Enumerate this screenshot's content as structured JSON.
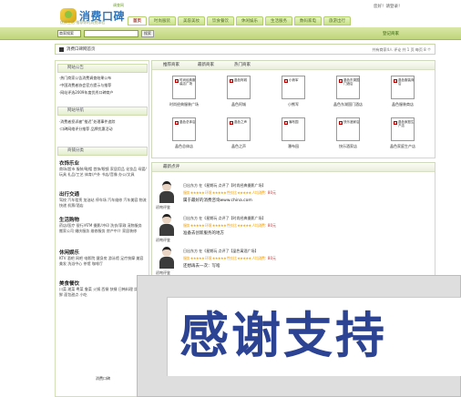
{
  "header": {
    "logo_text": "消费口碑",
    "logo_small": "调查网",
    "slogan": "优质生活·推荐你的消费体验",
    "login_text": "您好！请登录！"
  },
  "nav": {
    "items": [
      "首页",
      "时尚服装",
      "美容美妆",
      "饮食餐饮",
      "休闲娱乐",
      "生活服务",
      "数码家电",
      "旅游出行"
    ],
    "active_index": 0
  },
  "subnav": {
    "search_select": "商家搜索",
    "search_placeholder": "",
    "search_button": "搜索",
    "register_link": "登记商家"
  },
  "breadcrumb": {
    "text": "消费口碑网首页",
    "right_text": "共有商家4人   评论    共 1 页    每页 8 个"
  },
  "sidebar": {
    "section1_title": "网站公告",
    "notices": [
      "·热门商家公告消费调查结果公布",
      "·中国消费者协会官方提示与推荐",
      "·网站评选2009年度优秀口碑商户"
    ],
    "section2_title": "网站导航",
    "guide_lines": [
      "·消费者投诉被“推迟”处理事件追踪",
      "·口碑网络评分推荐 品牌优惠活动"
    ],
    "section3_title": "商铺分类",
    "categories": [
      {
        "name": "衣饰乐业",
        "links": "商场/超市 服装/鞋帽 首饰/眼镜 家居用品 化妆品 母婴/玩具 礼品/工艺 体育/户外 书店/音像 办公/文具"
      },
      {
        "name": "出行交通",
        "links": "驾校 汽车租赁 加油站 停车场 汽车维修 汽车美容 物流快递 机票/酒店"
      },
      {
        "name": "生活购物",
        "links": "药店/医疗 银行/ATM 摄影/冲印 洗衣/家政 宠物服务 搬家公司 婚庆服务 维修服务 房产中介 家居装修"
      },
      {
        "name": "休闲娱乐",
        "links": "KTV 酒吧 网吧 电影院 健身房 游泳馆 足疗按摩 美容美发 洗浴中心 茶馆 咖啡厅"
      },
      {
        "name": "美食餐饮",
        "links": "川菜 湘菜 粤菜 鲁菜 火锅 西餐 快餐 日韩料理 烧烤 海鲜 面包甜点 小吃"
      }
    ],
    "footer_text": "消费口碑"
  },
  "tabs_box": {
    "tabs": [
      "推荐商家",
      "最新商家",
      "热门商家"
    ],
    "items": [
      {
        "thumb": "时尚经典服装店广场",
        "label": "时尚经典服装广场"
      },
      {
        "thumb": "晶色阿城",
        "label": "晶色阿城"
      },
      {
        "thumb": "小熊军",
        "label": "小熊军"
      },
      {
        "thumb": "晶色东湖国门酒店",
        "label": "晶色东湖国门酒店"
      },
      {
        "thumb": "晶色服装商店",
        "label": "晶色服装商店"
      },
      {
        "thumb": "晶色总体店",
        "label": "晶色总体店"
      },
      {
        "thumb": "晶色之声",
        "label": "晶色之声"
      },
      {
        "thumb": "瀑布园",
        "label": "瀑布园"
      },
      {
        "thumb": "快乐酒家店",
        "label": "快乐酒家店"
      },
      {
        "thumb": "晶色家庭生产店",
        "label": "晶色家庭生产店"
      }
    ]
  },
  "reviews": {
    "title": "最新点评",
    "items": [
      {
        "user": "初吻评鉴",
        "meta": "日出东方 在《星期玩 点评了【时尚经典摄影广场】",
        "ratings": "服务 ★★★★★ 环境 ★★★★★ 性价比 ★★★★★ 人均消费：",
        "price": "80元",
        "content": "属于最好的消费咨询www.china.com"
      },
      {
        "user": "初吻评鉴",
        "meta": "日出东方 在《星期玩 点评了【时尚经典摄影广场】",
        "ratings": "服务 ★★★★★ 环境 ★★★★★ 性价比 ★★★★★ 人均消费：",
        "price": "80元",
        "content": "准备去创新服务的地方"
      },
      {
        "user": "初吻评鉴",
        "meta": "日出东方 在《星期玩 点评了【晶色寓酒广场】",
        "ratings": "服务 ★★★★★ 环境 ★★★★★ 性价比 ★★★★★ 人均消费：",
        "price": "80元",
        "content": "还想再去一次：写啥"
      }
    ]
  },
  "popup": {
    "text": "感谢支持"
  },
  "colors": {
    "nav_green": "#c9e287",
    "subnav_green": "#bfd57a",
    "popup_text": "#2c4393",
    "link_blue": "#1a4f8f"
  }
}
